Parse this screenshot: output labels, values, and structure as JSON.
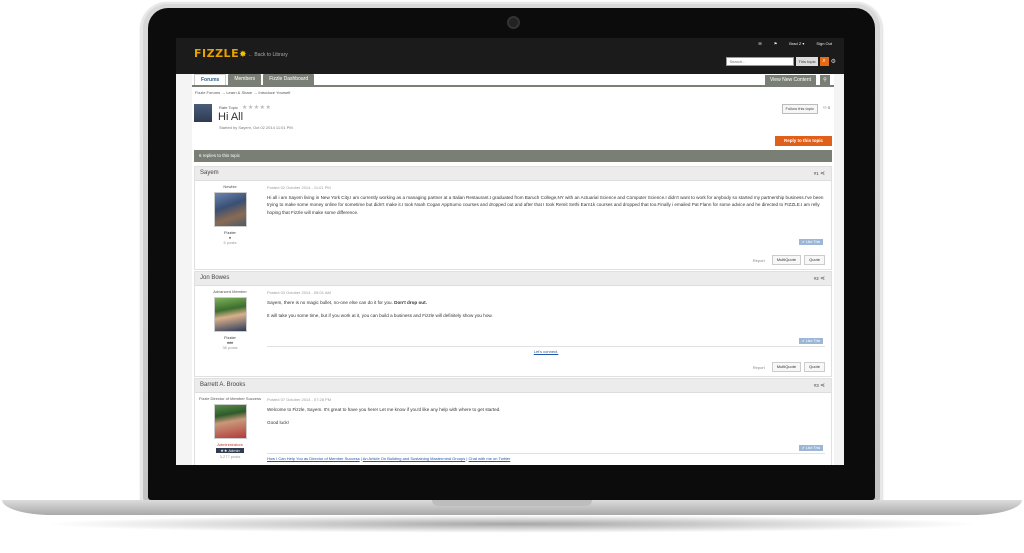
{
  "header": {
    "logo": "FIZZLE",
    "back_link": "← Back to Library",
    "user_name": "Brad Z ▾",
    "sign_out": "Sign Out",
    "search_placeholder": "Search...",
    "search_scope": "This topic"
  },
  "tabs": [
    {
      "label": "Forums"
    },
    {
      "label": "Members"
    },
    {
      "label": "Fizzle Dashboard"
    }
  ],
  "view_new_content": "View New Content",
  "breadcrumb": "Fizzle Forums  →  Learn & Share  →  Introduce Yourself",
  "topic": {
    "rate_label": "Rate Topic",
    "title": "Hi All",
    "started_by": "Started by Sayem, Oct 02 2014 11:01 PM",
    "follow_label": "Follow this topic",
    "follow_count": "0",
    "reply_label": "Reply to this topic",
    "replies_text": "6 replies to this topic"
  },
  "labels": {
    "like": "Like This",
    "report": "Report",
    "multiquote": "MultiQuote",
    "quote": "Quote"
  },
  "posts": [
    {
      "author": "Sayem",
      "num": "#1",
      "rank": "Newbie",
      "group": "Fizzler",
      "pips": "♦",
      "post_count": "5 posts",
      "posted": "Posted 02 October 2014 - 11:01 PM",
      "paragraphs": [
        "Hi all i am Sayem living in New York City.I am currently working as a managing partner at a Italian Restaurant.I graduated from Baruch College,NY with an Actuarial Science and Computer Science.I didn't want to work for anybody so started my partnership business.I've been trying to make some money online for sometime but didn't make it.I took Noah Cogan AppSumo courses and dropped out and after that I took Remit Sethi Earn1k courses and dropped that too.Finally i emailed Pat Flann for some advice and he directed to FIZZLE.I am relly hoping that Fizzle will make some difference."
      ]
    },
    {
      "author": "Jon Bowes",
      "num": "#2",
      "rank": "Advanced Member",
      "group": "Fizzler",
      "pips": "♦♦♦",
      "post_count": "36 posts",
      "posted": "Posted 03 October 2014 - 05:01 AM",
      "para1_text": "Sayem, there is no magic bullet, no-one else can do it for you. ",
      "para1_bold": "Don't drop out.",
      "para2": "It will take you some time, but if you work at it, you can build a business and Fizzle will definitely show you how.",
      "signature": "Let's connect."
    },
    {
      "author": "Barrett A. Brooks",
      "num": "#3",
      "rank": "Fizzle Director of Member Success",
      "group": "Administrators",
      "badge": "★★ Admin",
      "post_count": "3,277 posts",
      "posted": "Posted 07 October 2014 - 07:28 PM",
      "para1": "Welcome to Fizzle, Sayem. It's great to have you here! Let me know if you'd like any help with where to get started.",
      "para2": "Good luck!",
      "links": [
        "How I Can Help You as Director of Member Success",
        "An Article On Building and Sustaining Mastermind Groups",
        "Chat with me on Twitter"
      ]
    }
  ]
}
